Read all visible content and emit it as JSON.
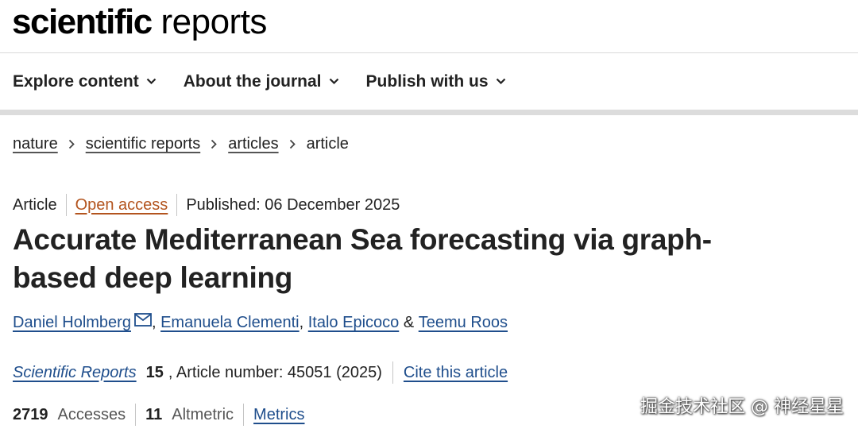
{
  "logo": {
    "bold": "scientific",
    "light": "reports"
  },
  "nav": {
    "items": [
      {
        "label": "Explore content"
      },
      {
        "label": "About the journal"
      },
      {
        "label": "Publish with us"
      }
    ]
  },
  "breadcrumb": {
    "items": [
      "nature",
      "scientific reports",
      "articles"
    ],
    "current": "article"
  },
  "meta": {
    "type": "Article",
    "access": "Open access",
    "published": "Published: 06 December 2025"
  },
  "title": "Accurate Mediterranean Sea forecasting via graph-based deep learning",
  "authors": {
    "list": [
      "Daniel Holmberg",
      "Emanuela Clementi",
      "Italo Epicoco",
      "Teemu Roos"
    ],
    "comma": ",",
    "ampersand": "&"
  },
  "journal": {
    "name": "Scientific Reports",
    "volume": "15",
    "article_number": ", Article number: 45051 (2025)",
    "cite": "Cite this article"
  },
  "metrics": {
    "accesses_count": "2719",
    "accesses_label": "Accesses",
    "altmetric_count": "11",
    "altmetric_label": "Altmetric",
    "link": "Metrics"
  },
  "watermark": "掘金技术社区 @ 神经星星",
  "colors": {
    "link": "#1f4e8c",
    "open_access": "#b3541e",
    "text": "#222222",
    "divider": "#dcdcdc"
  }
}
